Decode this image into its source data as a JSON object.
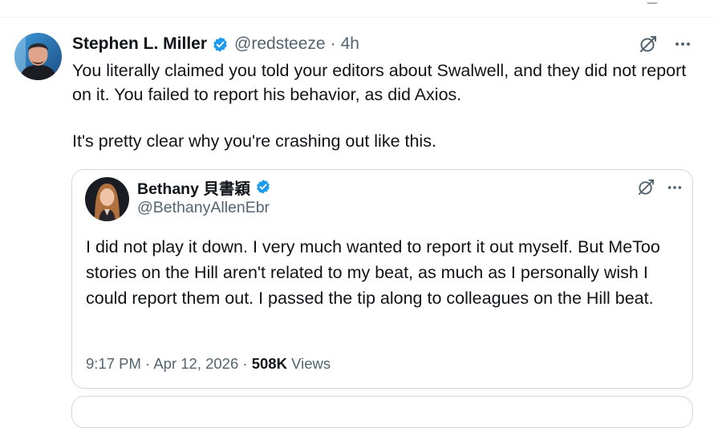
{
  "tweet": {
    "author_name": "Stephen L. Miller",
    "handle": "@redsteeze",
    "separator": "·",
    "time": "4h",
    "text_paragraphs": [
      "You literally claimed you told your editors about Swalwell, and they did not report on it. You failed to report his behavior, as did Axios.",
      "It's pretty clear why you're crashing out like this."
    ],
    "icons": {
      "verified": "verified-badge-icon",
      "grok": "grok-icon",
      "more": "more-options-icon"
    }
  },
  "quoted_tweet": {
    "author_name": "Bethany 貝書穎",
    "handle": "@BethanyAllenEbr",
    "text": "I did not play it down. I very much wanted to report it out myself. But MeToo stories on the Hill aren't related to my beat, as much as I personally wish I could report them out. I passed the tip along to colleagues on the Hill beat.",
    "timestamp": "9:17 PM · Apr 12, 2026",
    "meta_separator": "·",
    "views_count": "508K",
    "views_label": "Views"
  },
  "colors": {
    "verified": "#1d9bf0",
    "text": "#0f1419",
    "secondary": "#536471",
    "border": "#cfd9de"
  }
}
